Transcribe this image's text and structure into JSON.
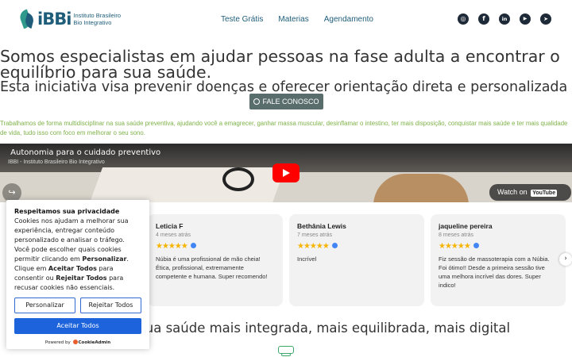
{
  "header": {
    "logo_text": "iBBi",
    "logo_sub_line1": "Instituto Brasileiro",
    "logo_sub_line2": "Bio Integrativo",
    "nav": [
      "Teste Grátis",
      "Materias",
      "Agendamento"
    ],
    "socials": [
      {
        "icon": "instagram-icon",
        "glyph": "◎"
      },
      {
        "icon": "facebook-icon",
        "glyph": "f"
      },
      {
        "icon": "linkedin-icon",
        "glyph": "in"
      },
      {
        "icon": "youtube-icon",
        "glyph": "▶"
      },
      {
        "icon": "telegram-icon",
        "glyph": "➤"
      }
    ]
  },
  "hero": {
    "title": "Somos especialistas em ajudar pessoas na fase adulta a encontrar o equilíbrio para sua saúde.",
    "subtitle": "Esta iniciativa visa prevenir doenças e oferecer orientação direta e personalizada",
    "cta_label": "FALE CONOSCO",
    "description": "Trabalhamos de forma multidisciplinar na sua saúde preventiva, ajudando você a emagrecer, ganhar massa muscular, desinflamar o intestino, ter mais disposição, conquistar mais saúde e ter mais qualidade de vida, tudo isso com foco em melhorar o seu sono."
  },
  "video": {
    "title": "󠁧 Autonomia para o cuidado preventivo 󠁧",
    "channel": "IBBI - Instituto Brasileiro Bio Integrativo",
    "watch_label": "Watch on",
    "youtube_label": "YouTube"
  },
  "reviews": [
    {
      "name": "Leticia F",
      "date": "4 meses atrás",
      "stars": "★★★★★",
      "text": "Núbia é uma profissional de mão cheia! Ética, profissional, extremamente competente e humana. Super recomendo!"
    },
    {
      "name": "Bethânia Lewis",
      "date": "7 meses atrás",
      "stars": "★★★★★",
      "text": "Incrível"
    },
    {
      "name": "jaqueline pereira",
      "date": "8 meses atrás",
      "stars": "★★★★★",
      "text": "Fiz sessão de massoterapia com a Núbia. Foi ótimo!! Desde a primeira sessão tive uma melhora incrível das dores. Super indico!"
    }
  ],
  "section2": {
    "title": "Cuide da sua saúde mais integrada, mais equilibrada, mais digital"
  },
  "cookie": {
    "title": "Respeitamos sua privacidade",
    "text_1": "Cookies nos ajudam a melhorar sua experiência, entregar conteúdo personalizado e analisar o tráfego. Você pode escolher quais cookies permitir clicando em ",
    "personalizar_bold": "Personalizar",
    "text_2": ". Clique em ",
    "aceitar_bold": "Aceitar Todos",
    "text_3": " para consentir ou ",
    "rejeitar_bold": "Rejeitar Todos",
    "text_4": " para recusar cookies não essenciais.",
    "btn_customize": "Personalizar",
    "btn_reject": "Rejeitar Todos",
    "btn_accept": "Aceitar Todos",
    "powered_by": "Powered by",
    "brand": "CookieAdmin"
  },
  "colors": {
    "brand": "#1f5d7a",
    "accent_green": "#7fb24a",
    "cookie_blue": "#1d63dc"
  }
}
